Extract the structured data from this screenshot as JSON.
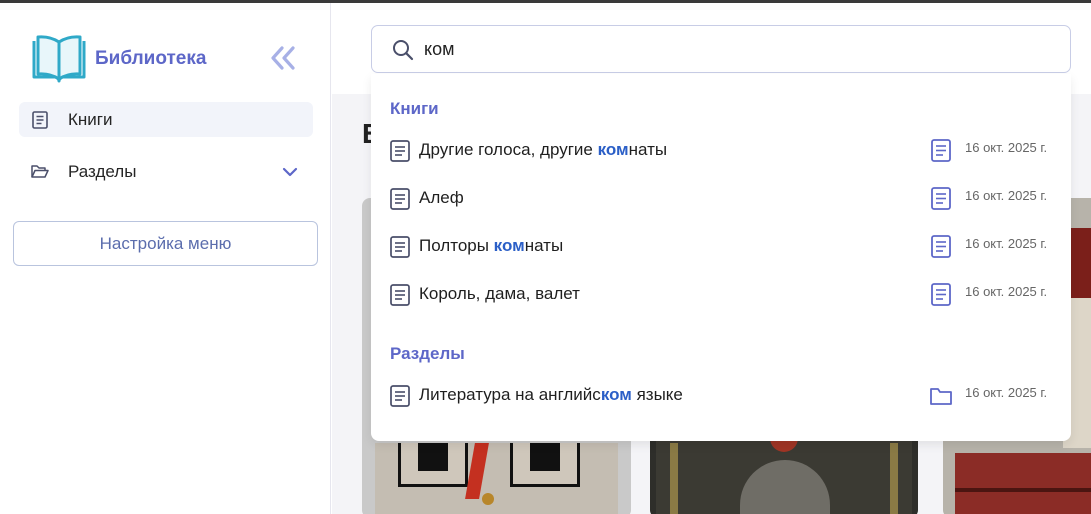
{
  "app": {
    "brand": "Библиотека"
  },
  "sidebar": {
    "items": [
      {
        "label": "Книги",
        "icon": "book-icon",
        "active": true
      },
      {
        "label": "Разделы",
        "icon": "folder-open-icon",
        "expandable": true
      }
    ],
    "menu_settings_label": "Настройка меню"
  },
  "search": {
    "value": "ком",
    "placeholder": ""
  },
  "main": {
    "title_partial": "Б"
  },
  "results": {
    "books_heading": "Книги",
    "books": [
      {
        "pre": "Другие голоса, другие ",
        "match": "ком",
        "post": "наты",
        "date": "16 окт. 2025 г.",
        "type_icon": "book-icon"
      },
      {
        "pre": "Алеф",
        "match": "",
        "post": "",
        "date": "16 окт. 2025 г.",
        "type_icon": "book-icon"
      },
      {
        "pre": "Полторы ",
        "match": "ком",
        "post": "наты",
        "date": "16 окт. 2025 г.",
        "type_icon": "book-icon"
      },
      {
        "pre": "Король, дама, валет",
        "match": "",
        "post": "",
        "date": "16 окт. 2025 г.",
        "type_icon": "book-icon"
      }
    ],
    "sections_heading": "Разделы",
    "sections": [
      {
        "pre": "Литература на английс",
        "match": "ком",
        "post": " языке",
        "date": "16 окт. 2025 г.",
        "type_icon": "folder-icon"
      }
    ]
  },
  "colors": {
    "accent": "#5d67c8",
    "highlight": "#2b5fc7",
    "logo": "#2fa9c8"
  }
}
